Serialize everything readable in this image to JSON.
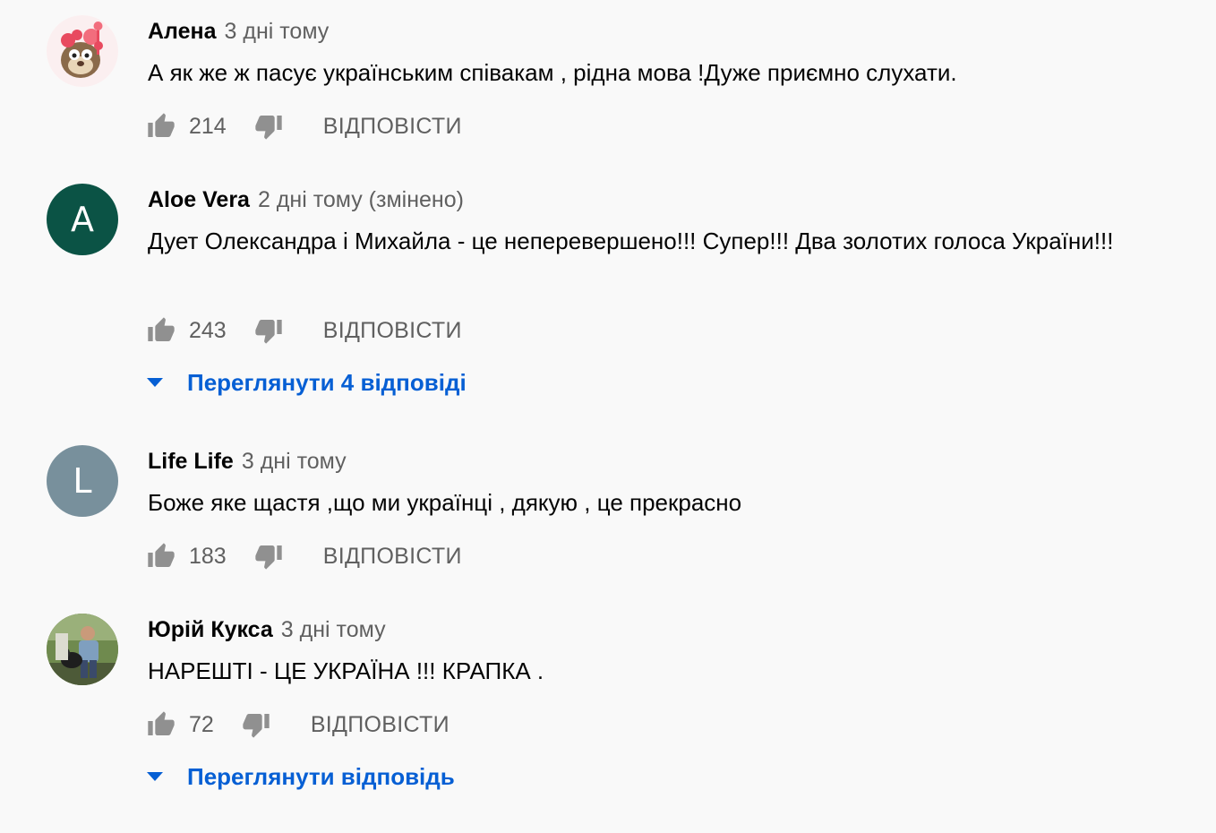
{
  "colors": {
    "background": "#f9f9f9",
    "author": "#030303",
    "meta": "#606060",
    "link": "#065fd4",
    "avatar_aloe": "#0b5345",
    "avatar_life": "#78909c"
  },
  "comments": [
    {
      "author": "Алена",
      "time": "3 дні тому",
      "text": "А як же ж пасує українським співакам , рідна мова !Дуже приємно слухати.",
      "likes": "214",
      "reply_label": "Відповісти",
      "avatar": {
        "type": "image",
        "icon": "cartoon-avatar-icon"
      }
    },
    {
      "author": "Aloe Vera",
      "time": "2 дні тому (змінено)",
      "text": "Дует Олександра і Михайла - це неперевершено!!! Супер!!! Два золотих голоса України!!!",
      "likes": "243",
      "reply_label": "Відповісти",
      "avatar": {
        "type": "letter",
        "letter": "A"
      },
      "view_replies": "Переглянути 4 відповіді"
    },
    {
      "author": "Life Life",
      "time": "3 дні тому",
      "text": "Боже яке щастя ,що ми українці , дякую , це прекрасно",
      "likes": "183",
      "reply_label": "Відповісти",
      "avatar": {
        "type": "letter",
        "letter": "L"
      }
    },
    {
      "author": "Юрій Кукса",
      "time": "3 дні тому",
      "text": "НАРЕШТІ - ЦЕ УКРАЇНА !!! КРАПКА .",
      "likes": "72",
      "reply_label": "Відповісти",
      "avatar": {
        "type": "image",
        "icon": "photo-avatar-icon"
      },
      "view_replies": "Переглянути відповідь"
    }
  ]
}
